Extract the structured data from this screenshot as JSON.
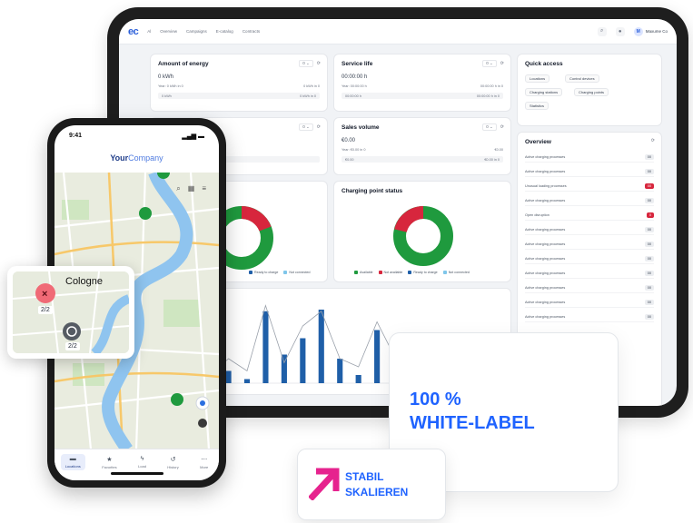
{
  "dashboard": {
    "logo": "ec",
    "nav": [
      "Al",
      "Overview",
      "Campaigns",
      "E-catalog",
      "Contracts"
    ],
    "user": "Maxume Co",
    "user_initial": "M",
    "cards": {
      "energy": {
        "title": "Amount of energy",
        "value": "0 kWh",
        "meta_left": "Year: 0 kWh in 0",
        "meta_right": "0 kWh in 0",
        "bar_left": "0 kWh",
        "bar_right": "0 kWh in 0"
      },
      "service": {
        "title": "Service life",
        "value": "00:00:00 h",
        "meta_left": "Year: 00:00:00 h",
        "meta_right": "00:00:00 h in 0",
        "bar_left": "00:00:00 h",
        "bar_right": "00:00:00 h in 0"
      },
      "sales": {
        "title": "Sales volume",
        "value": "€0.00",
        "meta_left": "Year: €0.00 in 0",
        "meta_right": "€0.00",
        "bar_left": "€0.00",
        "bar_right": "€0.00 in 0"
      },
      "status": {
        "title": "Charging point status"
      },
      "quick": {
        "title": "Quick access",
        "chips": [
          "Locations",
          "Control devices",
          "Charging stations",
          "Charging points",
          "Statistics"
        ]
      },
      "overview": {
        "title": "Overview",
        "rows": [
          {
            "label": "Active charging processes",
            "badge": "00",
            "alert": false
          },
          {
            "label": "Active charging processes",
            "badge": "00",
            "alert": false
          },
          {
            "label": "Unusual loading processes",
            "badge": "00",
            "alert": true
          },
          {
            "label": "Active charging processes",
            "badge": "00",
            "alert": false
          },
          {
            "label": "Open disruption",
            "badge": "0",
            "alert": true
          },
          {
            "label": "Active charging processes",
            "badge": "00",
            "alert": false
          },
          {
            "label": "Active charging processes",
            "badge": "00",
            "alert": false
          },
          {
            "label": "Active charging processes",
            "badge": "00",
            "alert": false
          },
          {
            "label": "Active charging processes",
            "badge": "00",
            "alert": false
          },
          {
            "label": "Active charging processes",
            "badge": "00",
            "alert": false
          },
          {
            "label": "Active charging processes",
            "badge": "00",
            "alert": false
          },
          {
            "label": "Active charging processes",
            "badge": "00",
            "alert": false
          }
        ]
      }
    },
    "status_legend": [
      "Available",
      "Not available",
      "Ready to charge",
      "Not connected"
    ],
    "left_legend": [
      "Ready to charge",
      "Not connected"
    ],
    "colors": {
      "green": "#1f9a3e",
      "red": "#d7263d",
      "blue": "#1f5fa8",
      "light_blue": "#7fc6ea"
    }
  },
  "phone": {
    "time": "9:41",
    "brand_bold": "Your",
    "brand_light": "Company",
    "tabs": [
      {
        "icon": "map-icon",
        "label": "Locations"
      },
      {
        "icon": "star-icon",
        "label": "Favorites"
      },
      {
        "icon": "bolt-icon",
        "label": "Load"
      },
      {
        "icon": "history-icon",
        "label": "History"
      },
      {
        "icon": "more-icon",
        "label": "More"
      }
    ],
    "marker_counts": [
      "2/2",
      "2/2"
    ]
  },
  "popup": {
    "city": "Cologne",
    "counts": [
      "2/2",
      "2/2"
    ]
  },
  "whitelabel": {
    "line1": "100 %",
    "line2": "WHITE-LABEL"
  },
  "stabil": {
    "line1": "STABIL",
    "line2": "SKALIEREN"
  },
  "chart_data": {
    "type": "bar",
    "values": [
      0.72,
      0.08,
      0.05,
      0.15,
      0.05,
      0.88,
      0.35,
      0.55,
      0.9,
      0.3,
      0.1,
      0.65,
      0.18,
      0.05,
      0.55,
      0.22,
      0.05,
      0.08
    ],
    "overlay_values": [
      0.8,
      0.3,
      0.1,
      0.3,
      0.15,
      0.95,
      0.25,
      0.7,
      0.88,
      0.3,
      0.2,
      0.75,
      0.3,
      0.1,
      0.6,
      0.3,
      0.1,
      0.1
    ]
  }
}
